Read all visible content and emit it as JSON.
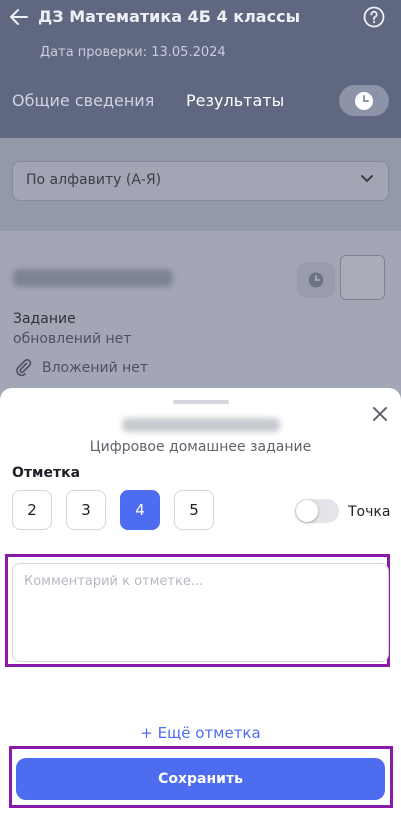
{
  "header": {
    "title": "ДЗ Математика 4Б 4 классы",
    "subtitle": "Дата проверки: 13.05.2024",
    "tabs": [
      {
        "label": "Общие сведения"
      },
      {
        "label": "Результаты"
      }
    ],
    "icons": {
      "back": "arrow-left-icon",
      "help": "question-circle-icon",
      "history": "clock-icon"
    }
  },
  "sort": {
    "selected": "По алфавиту (А-Я)"
  },
  "student_card": {
    "assignment_label": "Задание",
    "assignment_status": "обновлений нет",
    "attachments_text": "Вложений нет"
  },
  "sheet": {
    "subtitle": "Цифровое домашнее задание",
    "mark_label": "Отметка",
    "grades": [
      "2",
      "3",
      "4",
      "5"
    ],
    "selected_grade": "4",
    "dot_toggle_label": "Точка",
    "dot_toggle_on": false,
    "comment_placeholder": "Комментарий к отметке...",
    "comment_value": "",
    "add_mark_label": "+ Ещё отметка",
    "save_label": "Сохранить"
  },
  "colors": {
    "accent": "#4e6cf0",
    "highlight_frame": "#8a1aa8",
    "header_dimmed": "#5f6781"
  }
}
